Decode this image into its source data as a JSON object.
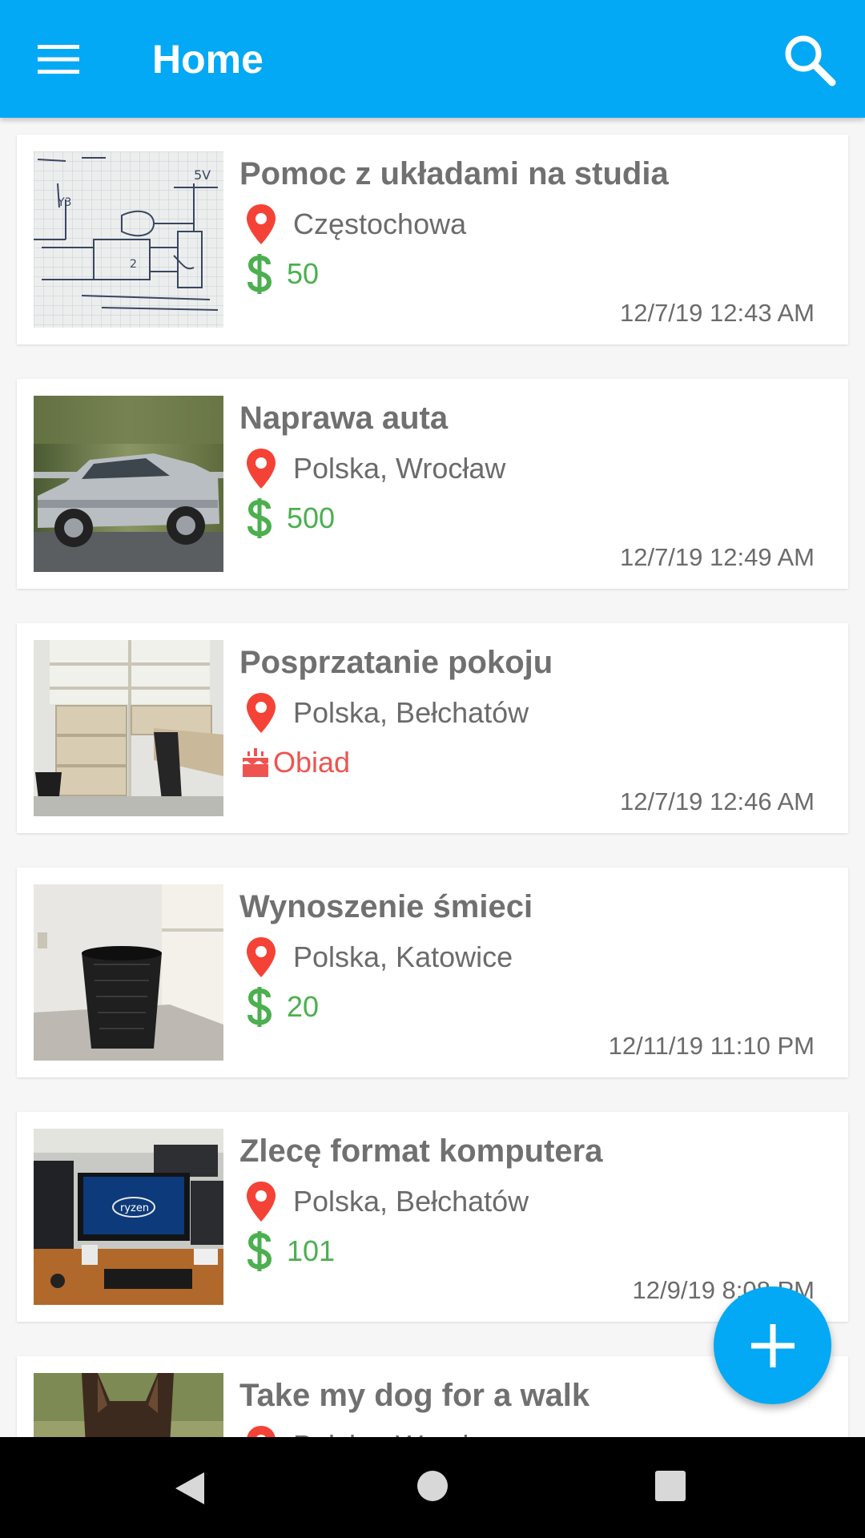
{
  "app": {
    "title": "Home"
  },
  "icons": {
    "menu": "menu-icon",
    "search": "search-icon",
    "location": "location-pin-icon",
    "price": "dollar-icon",
    "food": "cake-icon",
    "add": "plus-icon"
  },
  "colors": {
    "primary": "#03a9f4",
    "price": "#4caf50",
    "pin": "#f44336",
    "food": "#ef5350"
  },
  "listings": [
    {
      "title": "Pomoc z układami na studia",
      "location": "Częstochowa",
      "reward": "50",
      "reward_type": "money",
      "date": "12/7/19 12:43 AM",
      "thumb": "circuit-sketch"
    },
    {
      "title": "Naprawa auta",
      "location": "Polska, Wrocław",
      "reward": "500",
      "reward_type": "money",
      "date": "12/7/19 12:49 AM",
      "thumb": "silver-car"
    },
    {
      "title": "Posprzatanie pokoju",
      "location": "Polska, Bełchatów",
      "reward": "Obiad",
      "reward_type": "food",
      "date": "12/7/19 12:46 AM",
      "thumb": "room-cabinet"
    },
    {
      "title": "Wynoszenie śmieci",
      "location": "Polska, Katowice",
      "reward": "20",
      "reward_type": "money",
      "date": "12/11/19 11:10 PM",
      "thumb": "trash-bin"
    },
    {
      "title": "Zlecę format komputera",
      "location": "Polska, Bełchatów",
      "reward": "101",
      "reward_type": "money",
      "date": "12/9/19 8:08 PM",
      "thumb": "computer-desk"
    },
    {
      "title": "Take my dog for a walk",
      "location": "Polska, Wrocław",
      "reward": "",
      "reward_type": "money",
      "date": "",
      "thumb": "dog"
    }
  ],
  "system_nav": {
    "back": "back-icon",
    "home": "home-icon",
    "recents": "recents-icon"
  }
}
